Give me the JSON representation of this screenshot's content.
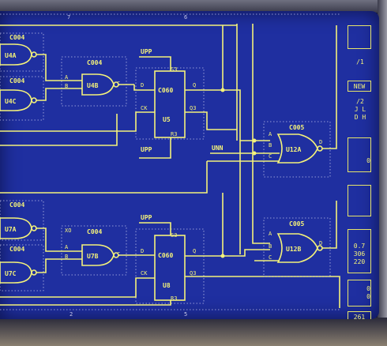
{
  "ruler_top": [
    "7",
    "6"
  ],
  "ruler_bottom": [
    "2",
    "5"
  ],
  "gates": {
    "u4a": {
      "label": "U4A",
      "part": "C004"
    },
    "u4c": {
      "label": "U4C",
      "part": "C004"
    },
    "u4b": {
      "label": "U4B",
      "part": "C004",
      "pin_a": "A",
      "pin_b": "B",
      "pin_out": "C"
    },
    "u5": {
      "label": "U5",
      "part": "C060",
      "pins": [
        "S3",
        "D",
        "Q",
        "CK",
        "Q3",
        "R3"
      ]
    },
    "u12a": {
      "label": "U12A",
      "part": "C005",
      "pins": [
        "A",
        "B",
        "C",
        "D"
      ]
    },
    "u7a": {
      "label": "U7A",
      "part": "C004"
    },
    "u7c": {
      "label": "U7C",
      "part": "C004"
    },
    "u7b": {
      "label": "U7B",
      "part": "C004",
      "pin_a": "A",
      "pin_b": "B",
      "pin_out": "C",
      "pin_ref": "XO"
    },
    "u8": {
      "label": "U8",
      "part": "C060",
      "pins": [
        "S3",
        "D",
        "Q",
        "CK",
        "Q3",
        "R3"
      ]
    },
    "u12b": {
      "label": "U12B",
      "part": "C005",
      "pins": [
        "A",
        "B",
        "C",
        "D"
      ]
    }
  },
  "nets": {
    "upp_top": "UPP",
    "upp_mid": "UPP",
    "upp_low": "UPP",
    "unn": "UNN"
  },
  "sidebar": {
    "item_1": "/1",
    "item_2": "NEW",
    "item_3": [
      "/2",
      "J L",
      "D H"
    ],
    "item_4": "0",
    "item_5": [
      "0.7",
      "306",
      "220"
    ],
    "item_6": [
      "0",
      "0"
    ],
    "item_7": "261"
  },
  "colors": {
    "screen": "#1f2fa0",
    "lines": "#f4f27a",
    "text": "#f4f27a",
    "dots": "#c9c9e8"
  }
}
